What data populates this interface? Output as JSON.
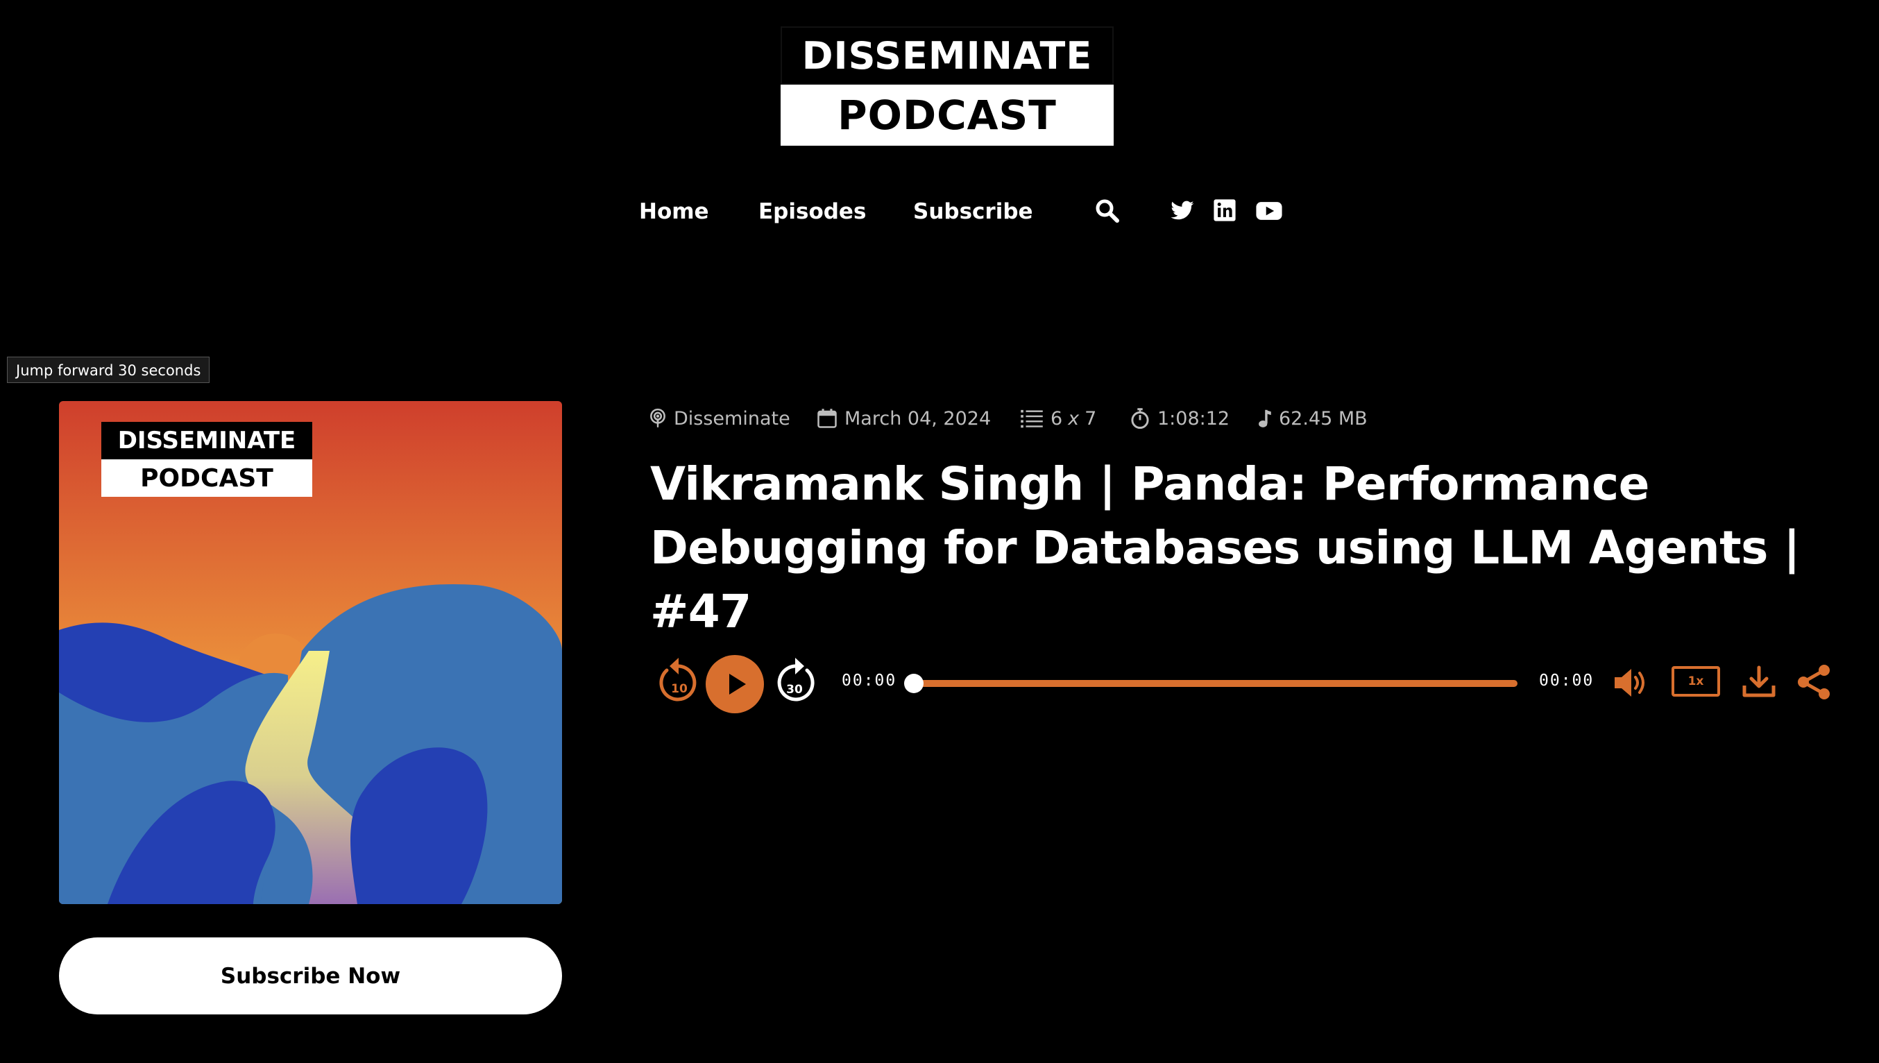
{
  "logo": {
    "line1": "DISSEMINATE",
    "line2": "PODCAST"
  },
  "nav": {
    "items": [
      "Home",
      "Episodes",
      "Subscribe"
    ],
    "icons": [
      "search-icon",
      "twitter-icon",
      "linkedin-icon",
      "youtube-icon"
    ]
  },
  "tooltip": "Jump forward 30 seconds",
  "cover": {
    "line1": "DISSEMINATE",
    "line2": "PODCAST"
  },
  "subscribe_button": "Subscribe Now",
  "meta": {
    "show": "Disseminate",
    "date": "March 04, 2024",
    "season_episode_prefix": "6",
    "season_episode_x": "x",
    "season_episode_suffix": "7",
    "duration": "1:08:12",
    "size": "62.45 MB"
  },
  "episode": {
    "title_line1": "Vikramank Singh | Panda: Performance",
    "title_line2": "Debugging for Databases using LLM Agents | #47"
  },
  "player": {
    "rewind_seconds": "10",
    "forward_seconds": "30",
    "current_time": "00:00",
    "total_time": "00:00",
    "speed": "1x",
    "progress": 0
  },
  "colors": {
    "accent": "#d86f2e",
    "background": "#000000"
  }
}
